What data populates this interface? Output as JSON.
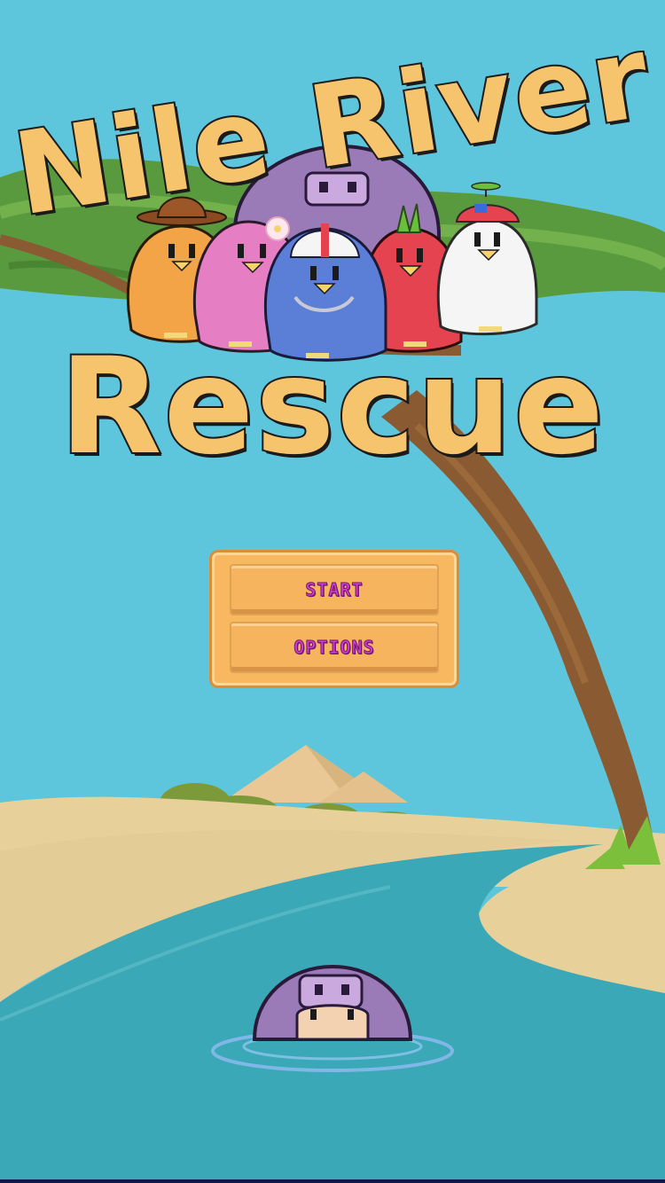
{
  "title": {
    "line1": "Nile River",
    "line2": "Rescue"
  },
  "menu": {
    "start_label": "START",
    "options_label": "OPTIONS"
  },
  "colors": {
    "sky": "#5ec6dc",
    "sand": "#e7d09a",
    "river": "#3aa8b6",
    "title_fill": "#f7c46e",
    "menu_panel": "#f7b860",
    "menu_text": "#d63ad4",
    "hippo": "#9a7bb8"
  },
  "characters": [
    "orange-bird-cowboy-hat",
    "pink-bird-flower",
    "blue-bird-football-helmet",
    "red-bird-leaf",
    "white-bird-propeller-cap"
  ]
}
